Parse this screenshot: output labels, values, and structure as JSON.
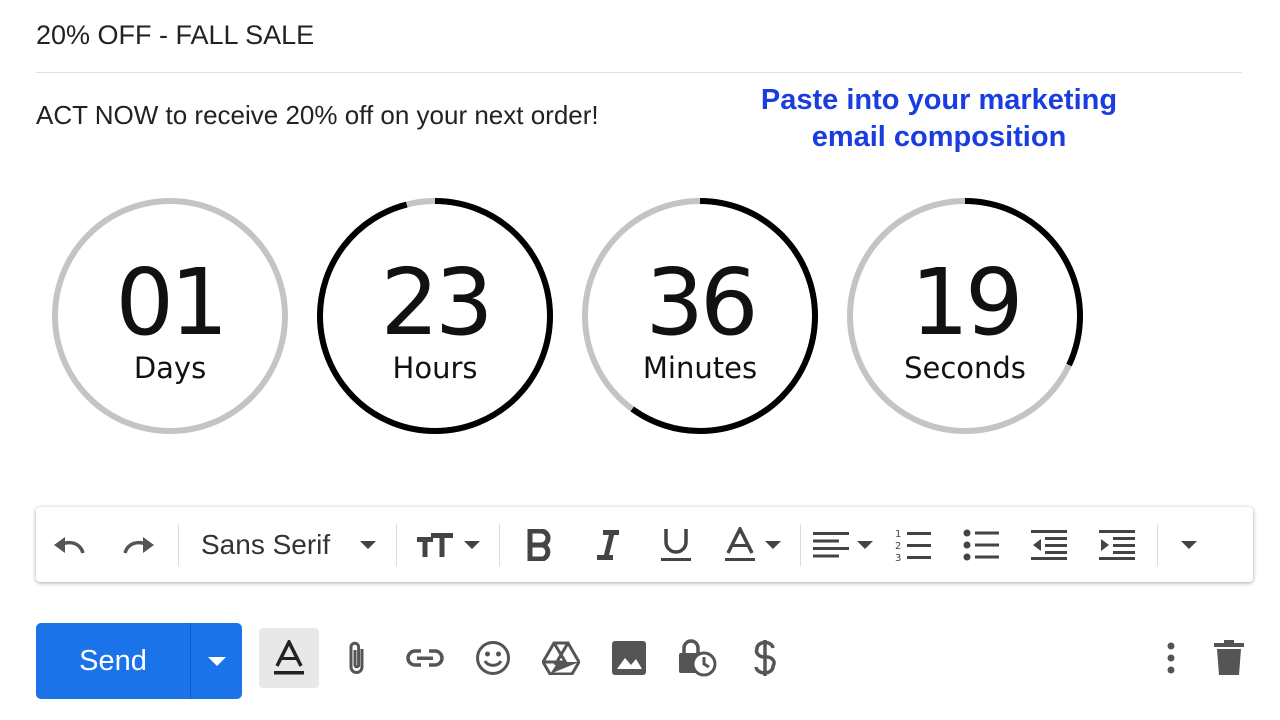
{
  "email": {
    "subject": "20% OFF - FALL SALE",
    "body_line": "ACT NOW to receive 20% off on your next order!"
  },
  "promo_text": {
    "line1": "Paste into your marketing",
    "line2": "email composition"
  },
  "countdown": [
    {
      "value": "01",
      "label": "Days",
      "progress": 0.0
    },
    {
      "value": "23",
      "label": "Hours",
      "progress": 0.96
    },
    {
      "value": "36",
      "label": "Minutes",
      "progress": 0.6
    },
    {
      "value": "19",
      "label": "Seconds",
      "progress": 0.32
    }
  ],
  "colors": {
    "ring_track": "#c4c4c4",
    "ring_progress": "#000000",
    "promo": "#1a3de0",
    "send": "#1a73e8"
  },
  "toolbar": {
    "font": "Sans Serif",
    "icons": [
      "undo-icon",
      "redo-icon",
      "text-size-icon",
      "bold-icon",
      "italic-icon",
      "underline-icon",
      "text-color-icon",
      "align-icon",
      "numbered-list-icon",
      "bulleted-list-icon",
      "indent-less-icon",
      "indent-more-icon",
      "more-formatting-icon"
    ]
  },
  "actions": {
    "send_label": "Send",
    "icons": [
      "formatting-options-icon",
      "attach-icon",
      "link-icon",
      "emoji-icon",
      "drive-icon",
      "photo-icon",
      "confidential-mode-icon",
      "dollar-icon",
      "more-options-icon",
      "trash-icon"
    ]
  }
}
